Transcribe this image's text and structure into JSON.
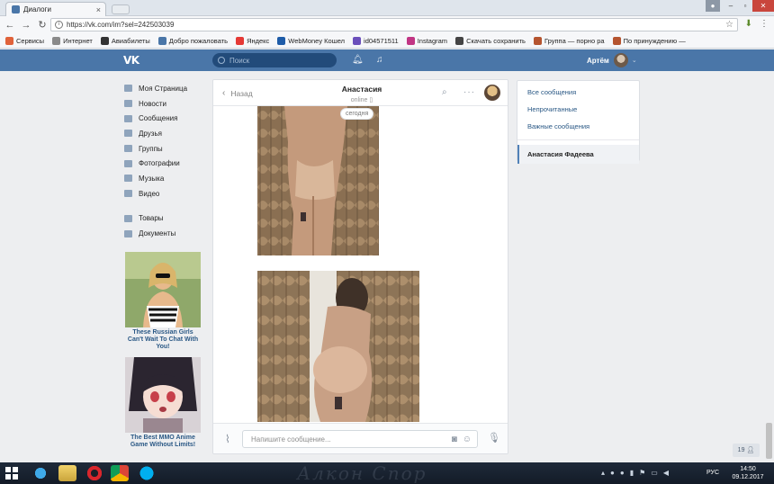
{
  "browser": {
    "tab_title": "Диалоги",
    "tab_close": "×",
    "url": "https://vk.com/im?sel=242503039",
    "bookmarks": [
      {
        "label": "Сервисы",
        "icon": "apps-icon",
        "color": "#e0623a"
      },
      {
        "label": "Интернет",
        "icon": "page-icon",
        "color": "#8a8a8a"
      },
      {
        "label": "Авиабилеты",
        "icon": "plane-icon",
        "color": "#333333"
      },
      {
        "label": "Добро пожаловать",
        "icon": "vk-icon",
        "color": "#4a76a8"
      },
      {
        "label": "Яндекс",
        "icon": "yandex-icon",
        "color": "#e53935"
      },
      {
        "label": "WebMoney Кошел",
        "icon": "webmoney-icon",
        "color": "#1e5ca8"
      },
      {
        "label": "id04571511",
        "icon": "skype-icon",
        "color": "#6b4fbb"
      },
      {
        "label": "Instagram",
        "icon": "instagram-icon",
        "color": "#c13584"
      },
      {
        "label": "Скачать сохранить",
        "icon": "download-icon",
        "color": "#444444"
      },
      {
        "label": "Группа — порно ра",
        "icon": "group-icon",
        "color": "#b5542f"
      },
      {
        "label": "По принуждению —",
        "icon": "group-icon",
        "color": "#b5542f"
      }
    ]
  },
  "vk_header": {
    "logo": "VK",
    "search_placeholder": "Поиск",
    "user_name": "Артём"
  },
  "left_nav": {
    "items": [
      {
        "label": "Моя Страница",
        "icon": "home-icon"
      },
      {
        "label": "Новости",
        "icon": "news-icon"
      },
      {
        "label": "Сообщения",
        "icon": "messages-icon"
      },
      {
        "label": "Друзья",
        "icon": "friends-icon"
      },
      {
        "label": "Группы",
        "icon": "groups-icon"
      },
      {
        "label": "Фотографии",
        "icon": "photos-icon"
      },
      {
        "label": "Музыка",
        "icon": "music-icon"
      },
      {
        "label": "Видео",
        "icon": "video-icon"
      }
    ],
    "items2": [
      {
        "label": "Товары",
        "icon": "market-icon"
      },
      {
        "label": "Документы",
        "icon": "documents-icon"
      }
    ]
  },
  "ads": [
    {
      "caption": "These Russian Girls Can't Wait To Chat With You!"
    },
    {
      "caption": "The Best MMO Anime Game Without Limits!"
    }
  ],
  "chat": {
    "back_label": "Назад",
    "peer_name": "Анастасия",
    "peer_status": "online",
    "date_badge": "сегодня",
    "composer_placeholder": "Напишите сообщение..."
  },
  "folders": {
    "items": [
      "Все сообщения",
      "Непрочитанные",
      "Важные сообщения"
    ],
    "active_dialog": "Анастасия Фадеева"
  },
  "pager": "19",
  "taskbar": {
    "lang": "РУС",
    "time": "14:50",
    "date": "09.12.2017",
    "watermark": "Алкон Спор"
  }
}
